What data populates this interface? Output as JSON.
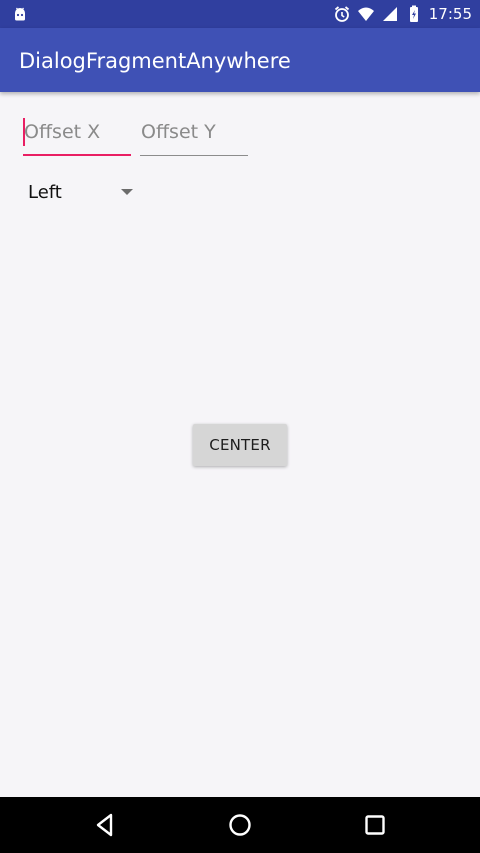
{
  "status_bar": {
    "time": "17:55",
    "left_icon": "android-notification-icon",
    "right_icons": [
      "alarm-icon",
      "wifi-icon",
      "signal-icon",
      "battery-charging-icon"
    ]
  },
  "app_bar": {
    "title": "DialogFragmentAnywhere"
  },
  "form": {
    "offset_x": {
      "value": "",
      "placeholder": "Offset X"
    },
    "offset_y": {
      "value": "",
      "placeholder": "Offset Y"
    },
    "gravity_spinner": {
      "selected": "Left"
    }
  },
  "center_button": {
    "label": "CENTER"
  },
  "nav_bar": {
    "items": [
      "back-icon",
      "home-icon",
      "recents-icon"
    ]
  },
  "colors": {
    "status_bar": "#303f9f",
    "app_bar": "#3f51b5",
    "accent": "#e91e63",
    "background": "#f6f5f8",
    "nav_bar": "#000000"
  }
}
